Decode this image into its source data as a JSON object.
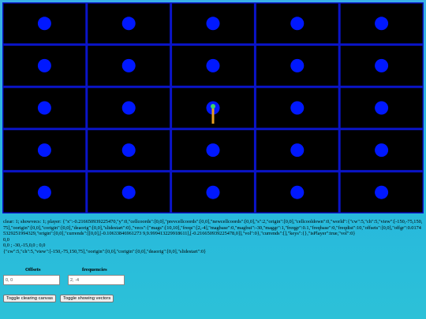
{
  "debug_lines": [
    "clear: 1; showvecs: 1; player: {\"x\":-0.216650939225470,\"y\":0,\"cellcoords\":[0,0],\"prevcellcoords\":[0,0],\"newcellcoords\":[0,0],\"s\":2,\"origin\":[0,0],\"cellcooldown\":0,\"world\":{\"cw\":5,\"ch\":5,\"view\":[-150,-75,150,75],\"oorigin\":[0,0],\"corigin\":[0,0],\"deaorig\":[0,0],\"slidestart\":0},\"vecs\":{\"mags\":[10,10],\"freqs\":[2,-4],\"magbase\":0,\"magbui\":-30,\"maggr\":1,\"freqgr\":0.1,\"freqbase\":0,\"freqdist\":10,\"offsets\":[0,0],\"offgr\":0.01745329251994329,\"origin\":[0,0],\"currends\":[[0,0],[-0.10633846961273 9,9.999413229918611],[-0.216650939225478,0]],\"vol\":0},\"currends\":[],\"keys\":{},\"isPlayer\":true,\"vol\":0}",
    "0,0",
    "0,0 ; -30,-15,0,0 ; 0,0",
    "{\"cw\":5,\"ch\":5,\"view\":[-150,-75,150,75],\"oorigin\":[0,0],\"corigin\":[0,0],\"deaorig\":[0,0],\"slidestart\":0}"
  ],
  "offsets_label": "Offsets",
  "frequencies_label": "frequencies",
  "offsets_value": "0, 0",
  "frequencies_value": "2, -4",
  "toggle_clear_label": "Toggle clearing canvas",
  "toggle_vectors_label": "Toggle showing vectors",
  "grid": {
    "cols": 5,
    "rows": 5
  },
  "colors": {
    "background": "#000000",
    "grid_line": "#0a14c8",
    "dot": "#0018ff",
    "vector": "#e8a020",
    "player": "#3fd46a"
  }
}
